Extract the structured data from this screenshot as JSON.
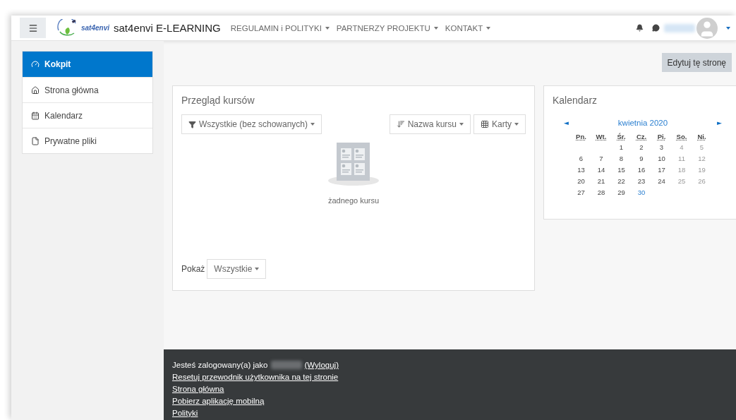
{
  "navbar": {
    "logo_text": "sat4envi",
    "site_name": "sat4envi E-LEARNING",
    "menus": [
      {
        "label": "REGULAMIN i POLITYKI"
      },
      {
        "label": "PARTNERZY PROJEKTU"
      },
      {
        "label": "KONTAKT"
      }
    ]
  },
  "sidebar": {
    "items": [
      {
        "label": "Kokpit",
        "selected": true
      },
      {
        "label": "Strona główna",
        "selected": false
      },
      {
        "label": "Kalendarz",
        "selected": false
      },
      {
        "label": "Prywatne pliki",
        "selected": false
      }
    ]
  },
  "edit_button": "Edytuj tę stronę",
  "course_overview": {
    "title": "Przegląd kursów",
    "filter": "Wszystkie (bez schowanych)",
    "sort": "Nazwa kursu",
    "view": "Karty",
    "empty_text": "żadnego kursu",
    "show_label": "Pokaż",
    "show_value": "Wszystkie"
  },
  "calendar": {
    "title": "Kalendarz",
    "prev": "◄",
    "next": "►",
    "month": "kwietnia 2020",
    "weekdays": [
      "Pn.",
      "Wt.",
      "Śr.",
      "Cz.",
      "Pi.",
      "So.",
      "Ni."
    ],
    "weeks": [
      {
        "days": [
          {
            "day": "1",
            "weekend": false,
            "today": false
          },
          {
            "day": "2",
            "weekend": false,
            "today": false
          },
          {
            "day": "3",
            "weekend": false,
            "today": false
          },
          {
            "day": "4",
            "weekend": true,
            "today": false
          },
          {
            "day": "5",
            "weekend": true,
            "today": false
          }
        ]
      },
      {
        "days": [
          {
            "day": "6",
            "weekend": false,
            "today": false
          },
          {
            "day": "7",
            "weekend": false,
            "today": false
          },
          {
            "day": "8",
            "weekend": false,
            "today": false
          },
          {
            "day": "9",
            "weekend": false,
            "today": false
          },
          {
            "day": "10",
            "weekend": false,
            "today": false
          },
          {
            "day": "11",
            "weekend": true,
            "today": false
          },
          {
            "day": "12",
            "weekend": true,
            "today": false
          }
        ]
      },
      {
        "days": [
          {
            "day": "13",
            "weekend": false,
            "today": false
          },
          {
            "day": "14",
            "weekend": false,
            "today": false
          },
          {
            "day": "15",
            "weekend": false,
            "today": false
          },
          {
            "day": "16",
            "weekend": false,
            "today": false
          },
          {
            "day": "17",
            "weekend": false,
            "today": false
          },
          {
            "day": "18",
            "weekend": true,
            "today": false
          },
          {
            "day": "19",
            "weekend": true,
            "today": false
          }
        ]
      },
      {
        "days": [
          {
            "day": "20",
            "weekend": false,
            "today": false
          },
          {
            "day": "21",
            "weekend": false,
            "today": false
          },
          {
            "day": "22",
            "weekend": false,
            "today": false
          },
          {
            "day": "23",
            "weekend": false,
            "today": false
          },
          {
            "day": "24",
            "weekend": false,
            "today": false
          },
          {
            "day": "25",
            "weekend": true,
            "today": false
          },
          {
            "day": "26",
            "weekend": true,
            "today": false
          }
        ]
      },
      {
        "days": [
          {
            "day": "27",
            "weekend": false,
            "today": false
          },
          {
            "day": "28",
            "weekend": false,
            "today": false
          },
          {
            "day": "29",
            "weekend": false,
            "today": false
          },
          {
            "day": "30",
            "weekend": false,
            "today": true
          }
        ]
      }
    ]
  },
  "footer": {
    "logged_in_text": "Jesteś zalogowany(a) jako",
    "logout_link": "(Wyloguj)",
    "links": [
      "Resetuj przewodnik użytkownika na tej stronie",
      "Strona główna",
      "Pobierz aplikację mobilną",
      "Polityki"
    ]
  }
}
